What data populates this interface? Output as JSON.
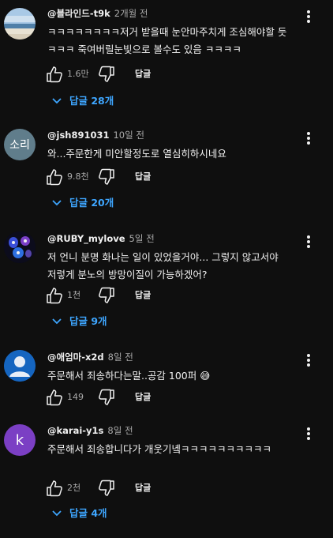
{
  "comments": [
    {
      "author": "@블라인드-t9k",
      "time": "2개월 전",
      "text": "ㅋㅋㅋㅋㅋㅋㅋㅋ저거 받을때 눈안마주치게 조심해야할 듯 ㅋㅋㅋ 죽여버릴눈빛으로 볼수도 있음 ㅋㅋㅋㅋ",
      "likes": "1.6만",
      "reply_label": "답글",
      "replies_label": "답글 28개",
      "avatar": "beach-photo"
    },
    {
      "author": "@jsh891031",
      "time": "10일 전",
      "text": "와...주문한게 미안할정도로 열심히하시네요",
      "likes": "9.8천",
      "reply_label": "답글",
      "replies_label": "답글 20개",
      "avatar_text": "소리",
      "avatar_color": "#607d8b"
    },
    {
      "author": "@RUBY_mylove",
      "time": "5일 전",
      "text": "저 언니 분명 화나는 일이 있었을거야... 그렇지 않고서야 저렇게 분노의 방망이질이 가능하겠어?",
      "likes": "1천",
      "reply_label": "답글",
      "replies_label": "답글 9개",
      "avatar": "art-photo"
    },
    {
      "author": "@애엄마-x2d",
      "time": "8일 전",
      "text": "주문해서 죄송하다는말..공감 100퍼 😅",
      "likes": "149",
      "reply_label": "답글",
      "avatar": "default-user",
      "avatar_color": "#1565c0"
    },
    {
      "author": "@karai-y1s",
      "time": "8일 전",
      "text": "주문해서 죄송합니다가 개웃기녴ㅋㅋㅋㅋㅋㅋㅋㅋㅋㅋ",
      "likes": "2천",
      "reply_label": "답글",
      "replies_label": "답글 4개",
      "avatar_text": "k",
      "avatar_color": "#7b3fc4"
    }
  ]
}
